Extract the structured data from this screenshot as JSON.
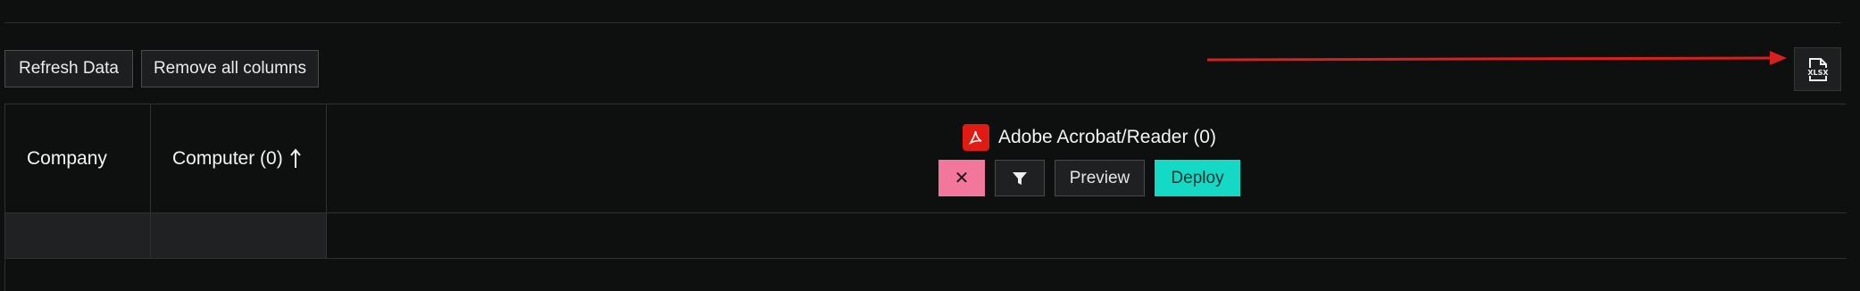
{
  "toolbar": {
    "refresh_label": "Refresh Data",
    "remove_label": "Remove all columns",
    "export_icon": "xlsx-file-icon"
  },
  "annotation": {
    "arrow_color": "#d8201f",
    "arrow_icon": "arrow-right-icon"
  },
  "table": {
    "columns": [
      {
        "label": "Company"
      },
      {
        "label": "Computer (0)",
        "sort": "ascending"
      },
      {
        "label": "Adobe Acrobat/Reader (0)",
        "icon": "adobe-acrobat-icon",
        "actions": {
          "remove_label": "✕",
          "filter_icon": "filter-icon",
          "preview_label": "Preview",
          "deploy_label": "Deploy"
        }
      }
    ]
  },
  "colors": {
    "background": "#0e0f0f",
    "remove_accent": "#f3779d",
    "deploy_accent": "#14d9c4",
    "pdf_red": "#e01b13"
  }
}
